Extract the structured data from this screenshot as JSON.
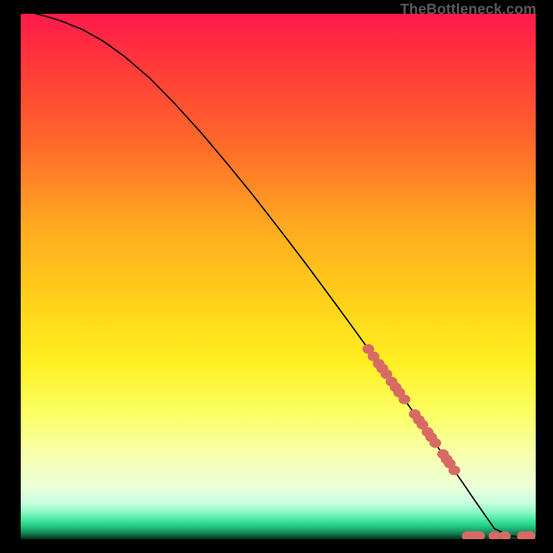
{
  "watermark": {
    "text": "TheBottleneck.com"
  },
  "chart_data": {
    "type": "line",
    "title": "",
    "xlabel": "",
    "ylabel": "",
    "xlim": [
      0,
      100
    ],
    "ylim": [
      0,
      100
    ],
    "grid": false,
    "series": [
      {
        "name": "curve",
        "kind": "line",
        "x": [
          3,
          5,
          8,
          12,
          16,
          20,
          25,
          30,
          35,
          40,
          45,
          50,
          55,
          60,
          65,
          70,
          75,
          79,
          80,
          82,
          84,
          86,
          88,
          90,
          92,
          95,
          98,
          100
        ],
        "y": [
          100,
          99.5,
          98.6,
          97,
          94.8,
          92,
          87.8,
          82.8,
          77.4,
          71.6,
          65.6,
          59.3,
          52.9,
          46.3,
          39.6,
          32.8,
          25.9,
          20.3,
          18.9,
          16.1,
          13.3,
          10.5,
          7.6,
          4.8,
          2,
          0.6,
          0.5,
          0.5
        ]
      },
      {
        "name": "markers",
        "kind": "scatter",
        "x": [
          67.5,
          68.5,
          69.5,
          70.2,
          71.0,
          72.0,
          72.8,
          73.5,
          74.5,
          76.5,
          77.3,
          78.0,
          79.0,
          79.7,
          80.5,
          82.0,
          82.7,
          83.3,
          84.2,
          86.8,
          87.7,
          88.3,
          89.0,
          92.0,
          94.0,
          97.5,
          98.3,
          98.8
        ],
        "y": [
          36.2,
          34.8,
          33.4,
          32.5,
          31.4,
          30.0,
          28.9,
          27.9,
          26.6,
          23.8,
          22.7,
          21.8,
          20.4,
          19.4,
          18.3,
          16.2,
          15.2,
          14.4,
          13.1,
          0.6,
          0.6,
          0.6,
          0.6,
          0.6,
          0.6,
          0.6,
          0.6,
          0.6
        ]
      }
    ],
    "legend": false,
    "marker_color": "#d86a64",
    "line_color": "#000000"
  }
}
